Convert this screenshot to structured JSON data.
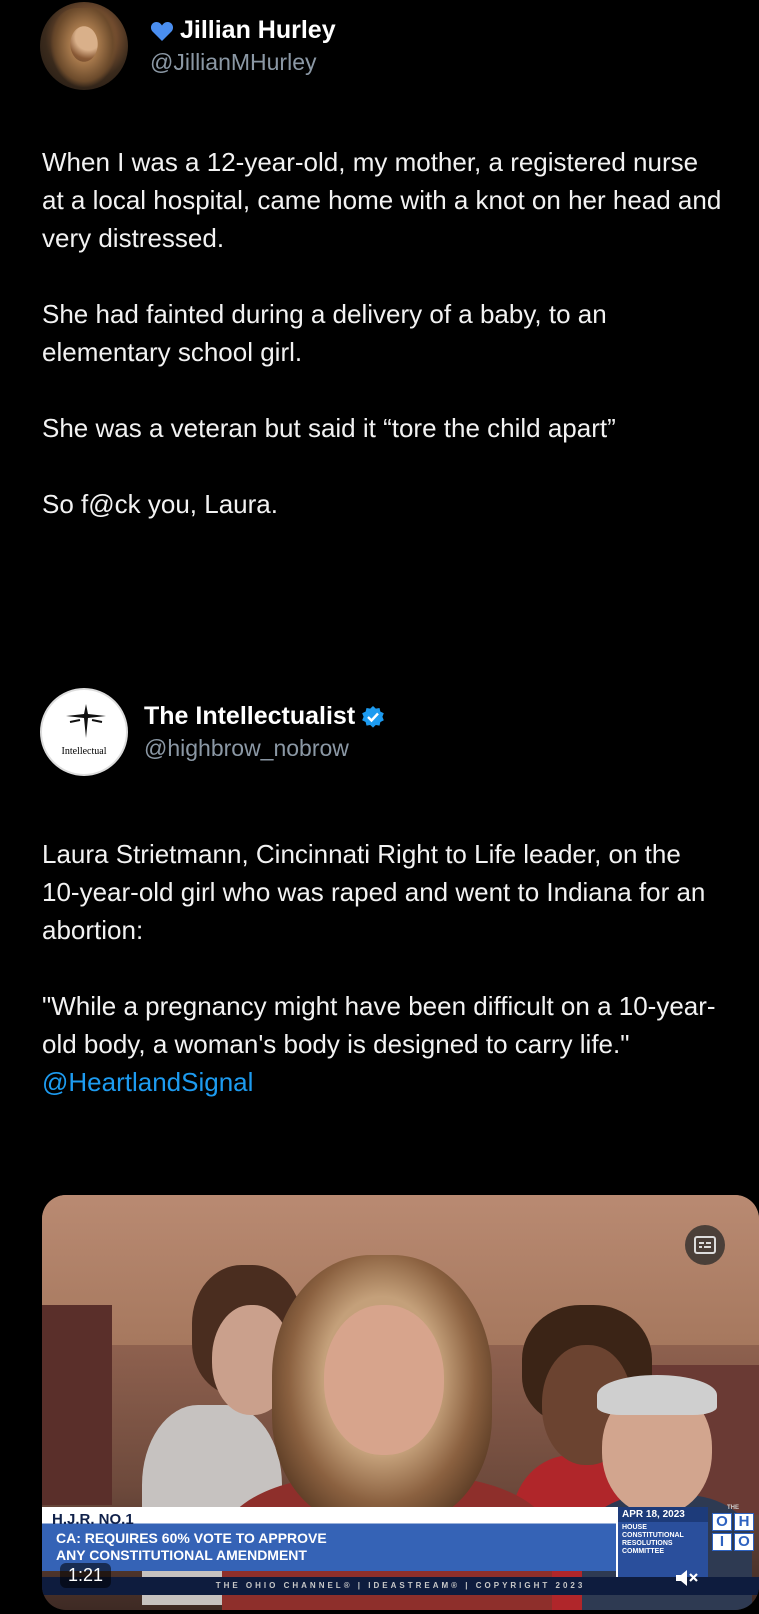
{
  "tweet": {
    "author": {
      "emoji": "💙",
      "display_name": "Jillian Hurley",
      "handle": "@JillianMHurley"
    },
    "paragraphs": [
      "When I was a 12-year-old, my mother, a registered nurse at a local hospital, came home with a knot on her head and very distressed.",
      "She had fainted during a delivery of a baby, to an elementary school girl.",
      "She was a veteran but said it “tore the child apart”",
      "So f@ck you, Laura."
    ]
  },
  "quoted_tweet": {
    "author": {
      "display_name": "The Intellectualist",
      "handle": "@highbrow_nobrow",
      "verified": true,
      "avatar_text": "Intellectual"
    },
    "paragraphs": [
      "Laura Strietmann, Cincinnati Right to Life leader, on the 10-year-old girl who was raped and went to Indiana for an abortion:",
      "\"While a pregnancy might have been difficult on a 10-year-old body, a woman's body is designed to carry life.\""
    ],
    "mention": "@HeartlandSignal"
  },
  "video": {
    "lower_third_title": "H.J.R. NO.1",
    "lower_third_line1": "CA: REQUIRES 60% VOTE TO APPROVE",
    "lower_third_line2": "ANY CONSTITUTIONAL AMENDMENT",
    "date": "APR 18, 2023",
    "committee": "HOUSE CONSTITUTIONAL RESOLUTIONS COMMITTEE",
    "channel_logo_the": "THE",
    "channel_logo_letters": [
      "O",
      "H",
      "I",
      "O"
    ],
    "ticker": "THE OHIO CHANNEL® | IDEASTREAM® | COPYRIGHT 2023",
    "timecode": "1:21"
  },
  "colors": {
    "background": "#000000",
    "link": "#1d9bf0",
    "verified": "#1d9bf0",
    "heart": "#4a8ef0"
  },
  "icons": [
    "blue-heart-icon",
    "verified-badge-icon",
    "closed-captions-icon",
    "mute-icon"
  ]
}
